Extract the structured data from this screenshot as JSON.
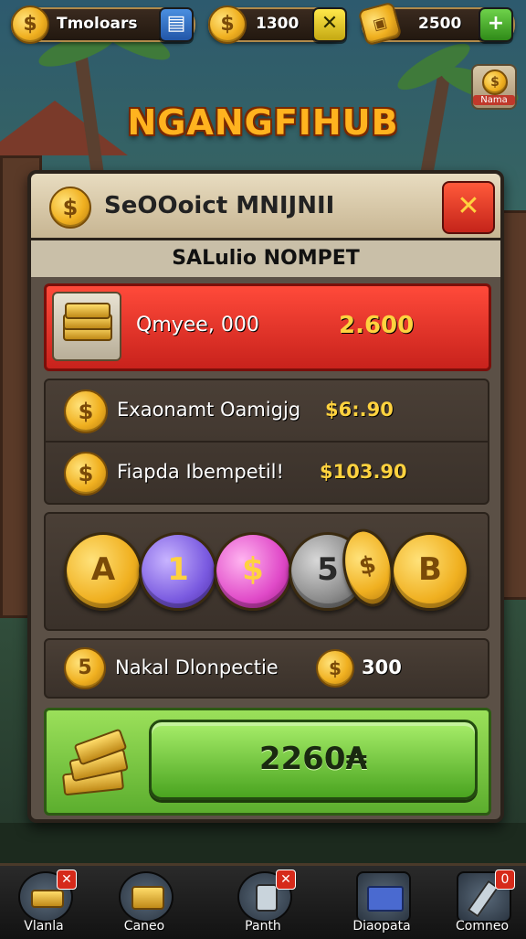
{
  "topbar": {
    "res1": {
      "label": "Tmoloars",
      "icon": "dollar-coin-icon",
      "btn": "menu-icon"
    },
    "res2": {
      "value": "1300",
      "icon": "dollar-coin-icon",
      "btn": "x-icon"
    },
    "res3": {
      "value": "2500",
      "icon": "coin-sack-icon",
      "btn": "plus-icon"
    }
  },
  "game_title": "NGANGFIHUB",
  "corner_button": {
    "label": "Nama",
    "icon": "coin-icon"
  },
  "panel": {
    "title": "SeOOoict MNIJNII",
    "subtitle": "SALulio NOMPET",
    "featured": {
      "label": "Qmyee, 000",
      "value": "2.600",
      "icon": "gold-stack-icon"
    },
    "rows": [
      {
        "label": "Exaonamt Oamigjg",
        "value": "$6:.90"
      },
      {
        "label": "Fiapda Ibempetil!",
        "value": "$103.90"
      }
    ],
    "chips": [
      {
        "glyph": "A",
        "kind": "gold"
      },
      {
        "glyph": "1",
        "kind": "purple"
      },
      {
        "glyph": "$",
        "kind": "pink"
      },
      {
        "glyph": "5",
        "kind": "silver"
      },
      {
        "glyph": "$",
        "kind": "gold-half"
      },
      {
        "glyph": "B",
        "kind": "gold"
      }
    ],
    "bonus": {
      "label": "Nakal Dlonpectie",
      "value": "300"
    },
    "claim": {
      "label": "2260₳"
    }
  },
  "coin_glyphs": {
    "dollar": "$",
    "five": "5"
  },
  "bottom_nav": [
    {
      "label": "Vlanla",
      "badge": "✕"
    },
    {
      "label": "Caneo",
      "badge": ""
    },
    {
      "label": "Panth",
      "badge": "✕"
    },
    {
      "label": "Diaopata",
      "badge": ""
    },
    {
      "label": "Comneo",
      "badge": "0"
    }
  ],
  "colors": {
    "accent_gold": "#ffb31f",
    "red": "#e0312a",
    "green": "#6cc23a",
    "panel": "#5b5046"
  }
}
